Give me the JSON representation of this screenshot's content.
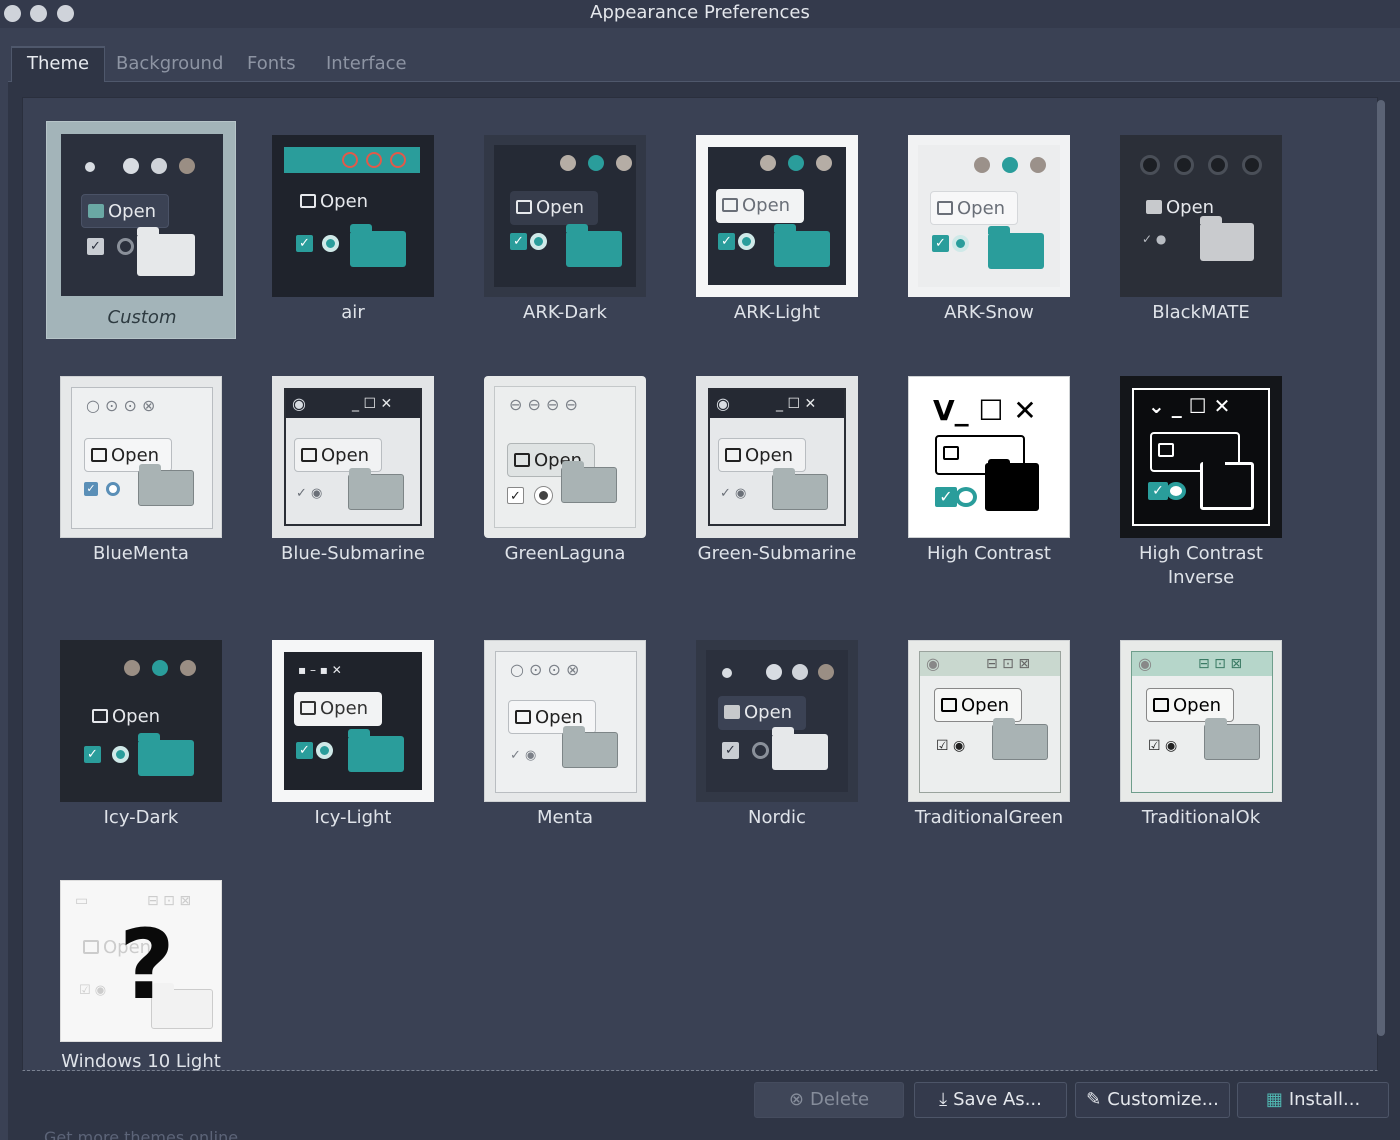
{
  "window": {
    "title": "Appearance Preferences"
  },
  "tabs": [
    {
      "label": "Theme",
      "active": true
    },
    {
      "label": "Background",
      "active": false
    },
    {
      "label": "Fonts",
      "active": false
    },
    {
      "label": "Interface",
      "active": false
    }
  ],
  "preview_open_label": "Open",
  "themes": [
    {
      "name": "Custom",
      "selected": true
    },
    {
      "name": "air"
    },
    {
      "name": "ARK-Dark"
    },
    {
      "name": "ARK-Light"
    },
    {
      "name": "ARK-Snow"
    },
    {
      "name": "BlackMATE"
    },
    {
      "name": "BlueMenta"
    },
    {
      "name": "Blue-Submarine"
    },
    {
      "name": "GreenLaguna"
    },
    {
      "name": "Green-Submarine"
    },
    {
      "name": "High Contrast"
    },
    {
      "name": "High Contrast Inverse"
    },
    {
      "name": "Icy-Dark"
    },
    {
      "name": "Icy-Light"
    },
    {
      "name": "Menta"
    },
    {
      "name": "Nordic"
    },
    {
      "name": "TraditionalGreen"
    },
    {
      "name": "TraditionalOk"
    },
    {
      "name": "Windows 10 Light"
    }
  ],
  "unknown_preview_symbol": "?",
  "actions": {
    "delete": "Delete",
    "save_as": "Save As...",
    "customize": "Customize...",
    "install": "Install..."
  },
  "footer": {
    "link": "Get more themes online"
  },
  "colors": {
    "accent": "#2a9d9b",
    "selected_bg": "#a3b4b9",
    "window_bg": "#3a4154"
  }
}
